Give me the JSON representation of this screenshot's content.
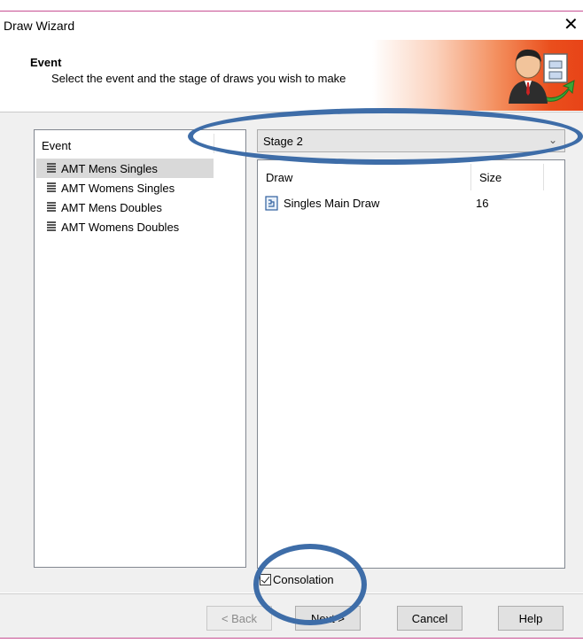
{
  "window": {
    "title": "Draw Wizard",
    "close_glyph": "✕"
  },
  "header": {
    "title": "Event",
    "subtitle": "Select the event and the stage of draws you wish to make",
    "logo_icon": "wizard-person-icon",
    "gradient_color": "#e84418"
  },
  "events": {
    "column_header": "Event",
    "items": [
      {
        "label": "AMT Mens Singles",
        "selected": true
      },
      {
        "label": "AMT Womens Singles",
        "selected": false
      },
      {
        "label": "AMT Mens Doubles",
        "selected": false
      },
      {
        "label": "AMT Womens Doubles",
        "selected": false
      }
    ]
  },
  "stage": {
    "selected": "Stage 2",
    "icon": "chevron-down-icon"
  },
  "draws": {
    "columns": [
      "Draw",
      "Size"
    ],
    "rows": [
      {
        "name": "Singles Main Draw",
        "size": "16"
      }
    ]
  },
  "consolation": {
    "label": "Consolation",
    "checked": true
  },
  "buttons": {
    "back": "< Back",
    "next": "Next >",
    "cancel": "Cancel",
    "help": "Help"
  },
  "annotation_color": "#3e6da8"
}
